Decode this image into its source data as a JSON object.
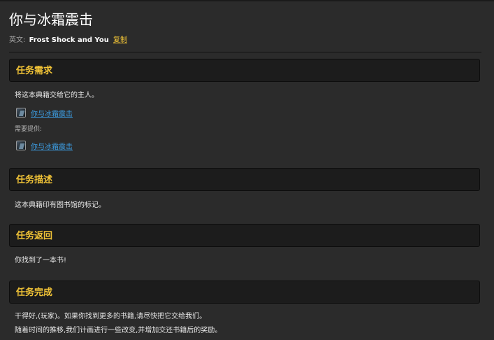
{
  "quest": {
    "title": "你与冰霜震击",
    "english_label": "英文:",
    "english_name": "Frost Shock and You",
    "copy_label": "复制"
  },
  "requirements": {
    "heading": "任务需求",
    "objective": "将这本典籍交给它的主人。",
    "item_name": "你与冰霜震击",
    "item_icon": "book-icon",
    "provided_label": "需要提供:",
    "provided_item_name": "你与冰霜震击",
    "provided_item_icon": "book-icon"
  },
  "description": {
    "heading": "任务描述",
    "text": "这本典籍印有图书馆的标记。"
  },
  "progress": {
    "heading": "任务返回",
    "text": "你找到了一本书!"
  },
  "completion": {
    "heading": "任务完成",
    "line1": "干得好,(玩家)。如果你找到更多的书籍,请尽快把它交给我们。",
    "line2": "随着时间的推移,我们计画进行一些改变,并增加交还书籍后的奖励。"
  },
  "colors": {
    "heading": "#f2c437",
    "link": "#3c9fe6",
    "background": "#2b2b2b",
    "panel": "#1c1c1c"
  }
}
